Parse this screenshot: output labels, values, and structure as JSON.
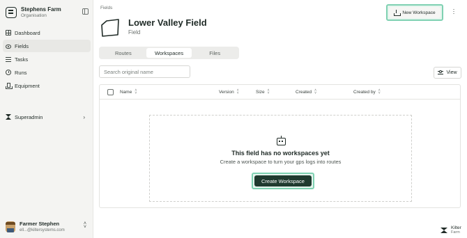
{
  "organisation": {
    "name": "Stephens Farm",
    "subtitle": "Organisation"
  },
  "sidebar": {
    "items": [
      {
        "label": "Dashboard",
        "icon": "dashboard-icon"
      },
      {
        "label": "Fields",
        "icon": "fields-icon",
        "active": true
      },
      {
        "label": "Tasks",
        "icon": "tasks-icon"
      },
      {
        "label": "Runs",
        "icon": "runs-icon"
      },
      {
        "label": "Equipment",
        "icon": "equipment-icon"
      }
    ],
    "superadmin_label": "Superadmin"
  },
  "user": {
    "name": "Farmer Stephen",
    "email": "ell...@kiltersystems.com"
  },
  "breadcrumb": "Fields",
  "field": {
    "title": "Lower Valley Field",
    "subtitle": "Field"
  },
  "header": {
    "new_workspace_label": "New Workspace"
  },
  "tabs": [
    {
      "label": "Routes"
    },
    {
      "label": "Workspaces",
      "active": true
    },
    {
      "label": "Files"
    }
  ],
  "search": {
    "placeholder": "Search original name",
    "value": ""
  },
  "view_button": {
    "label": "View"
  },
  "table": {
    "columns": [
      "Name",
      "Version",
      "Size",
      "Created",
      "Created by"
    ]
  },
  "empty_state": {
    "title": "This field has no workspaces yet",
    "subtitle": "Create a workspace to turn your gps logs into routes",
    "button_label": "Create Workspace"
  },
  "brand": {
    "name": "Kilter",
    "sub": "Farm"
  },
  "colors": {
    "accent_highlight": "#7fd1b2",
    "primary_button": "#1f3a2f",
    "sidebar_bg": "#f4f4f2"
  }
}
